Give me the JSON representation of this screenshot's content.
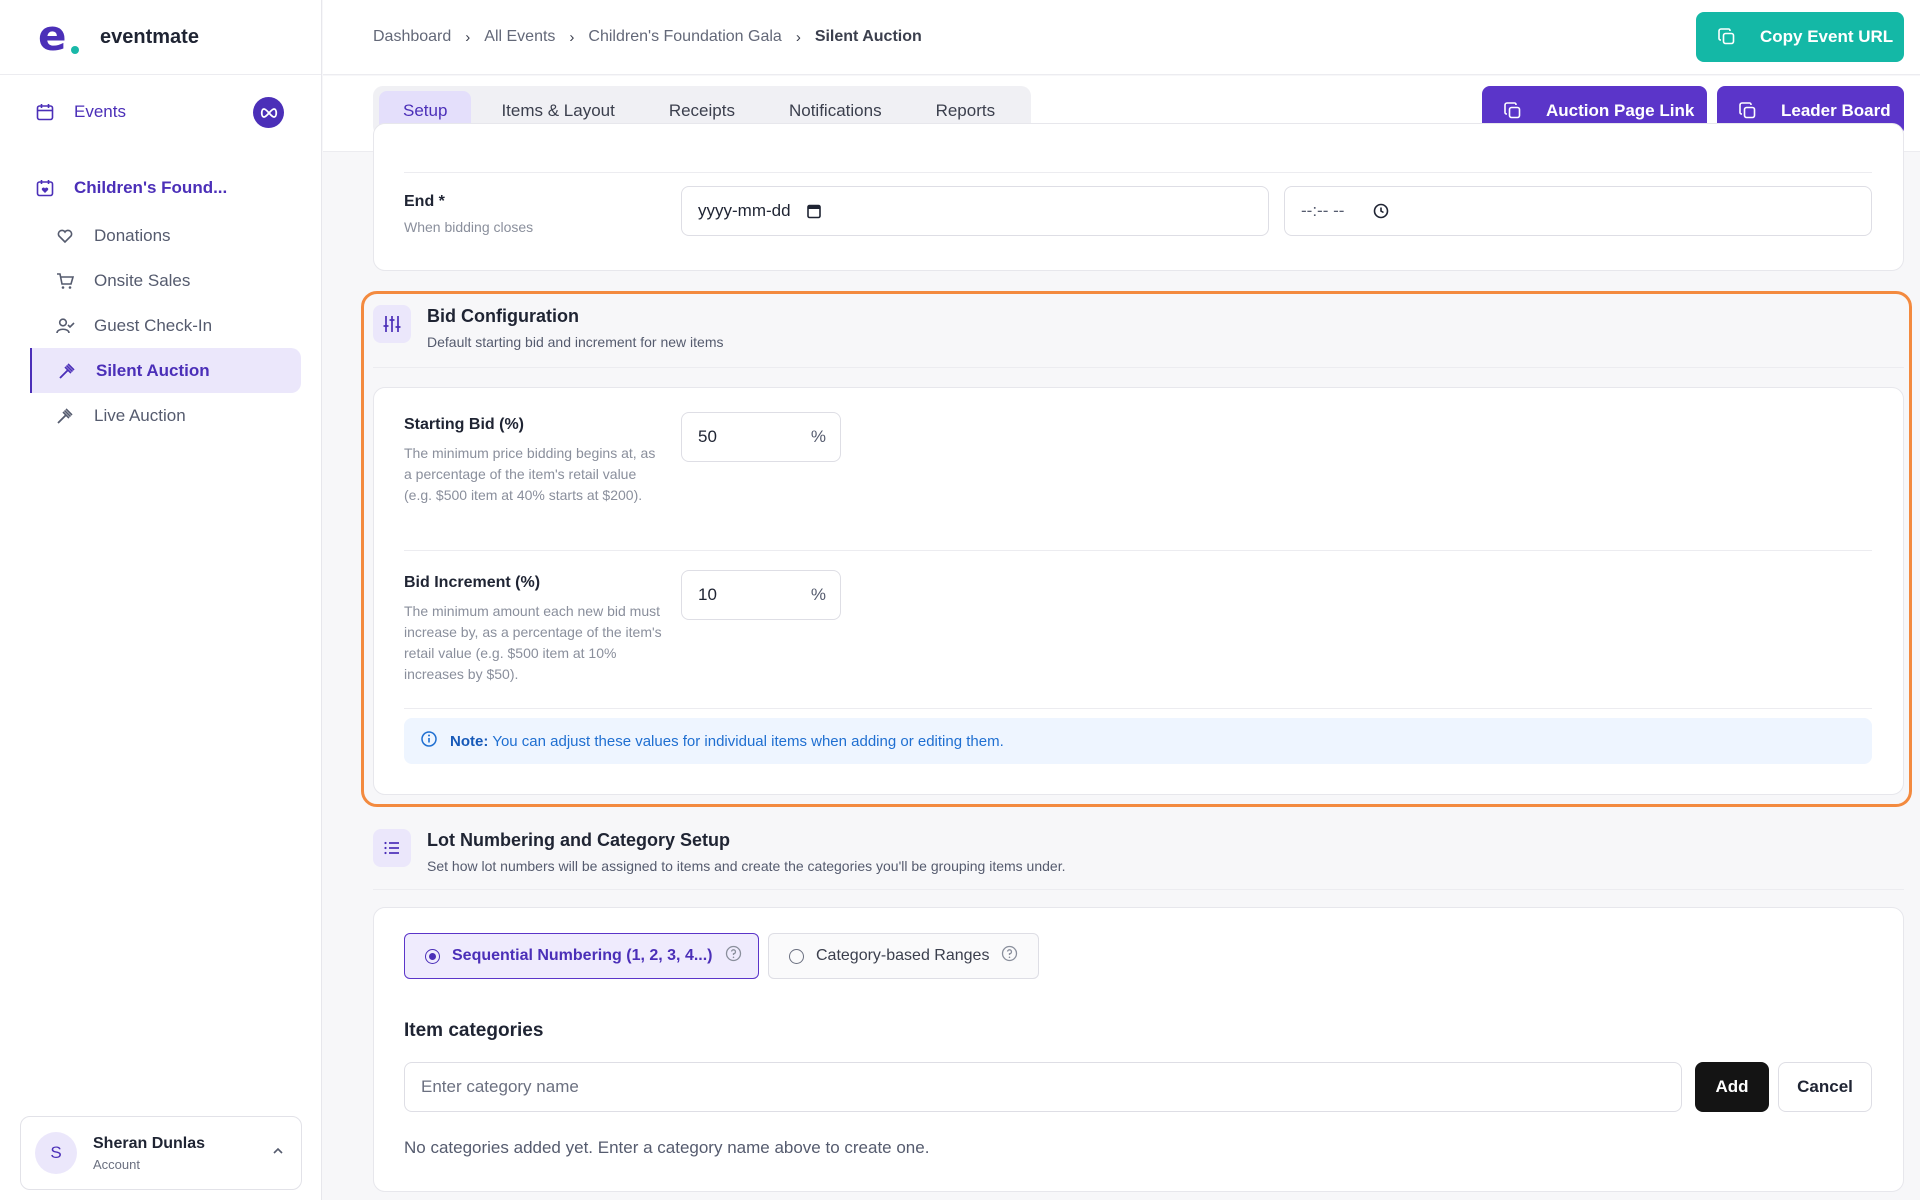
{
  "app": {
    "name": "eventmate"
  },
  "sidebar": {
    "events_label": "Events",
    "event_name": "Children's Found...",
    "items": [
      {
        "label": "Donations",
        "icon": "heart-hand-icon"
      },
      {
        "label": "Onsite Sales",
        "icon": "cart-icon"
      },
      {
        "label": "Guest Check-In",
        "icon": "user-check-icon"
      },
      {
        "label": "Silent Auction",
        "icon": "gavel-icon",
        "active": true
      },
      {
        "label": "Live Auction",
        "icon": "gavel-icon"
      }
    ],
    "account": {
      "initial": "S",
      "name": "Sheran Dunlas",
      "sub": "Account"
    }
  },
  "breadcrumb": [
    "Dashboard",
    "All Events",
    "Children's Foundation Gala",
    "Silent Auction"
  ],
  "header": {
    "copy_url_label": "Copy Event URL"
  },
  "tabs": [
    "Setup",
    "Items & Layout",
    "Receipts",
    "Notifications",
    "Reports"
  ],
  "actions": {
    "auction_page_link": "Auction Page Link",
    "leader_board": "Leader Board"
  },
  "end_field": {
    "label": "End *",
    "help": "When bidding closes",
    "date_placeholder": "yyyy-mm-dd",
    "time_placeholder": "--:-- --"
  },
  "bid_config": {
    "title": "Bid Configuration",
    "subtitle": "Default starting bid and increment for new items",
    "starting": {
      "label": "Starting Bid (%)",
      "help": "The minimum price bidding begins at, as a percentage of the item's retail value (e.g. $500 item at 40% starts at $200).",
      "value": "50",
      "suffix": "%"
    },
    "increment": {
      "label": "Bid Increment (%)",
      "help": "The minimum amount each new bid must increase by, as a percentage of the item's retail value (e.g. $500 item at 10% increases by $50).",
      "value": "10",
      "suffix": "%"
    },
    "note_label": "Note:",
    "note_text": "You can adjust these values for individual items when adding or editing them."
  },
  "lot": {
    "title": "Lot Numbering and Category Setup",
    "subtitle": "Set how lot numbers will be assigned to items and create the categories you'll be grouping items under.",
    "option_sequential": "Sequential Numbering (1, 2, 3, 4...)",
    "option_category": "Category-based Ranges",
    "categories_title": "Item categories",
    "category_placeholder": "Enter category name",
    "add_label": "Add",
    "cancel_label": "Cancel",
    "empty_text": "No categories added yet. Enter a category name above to create one."
  },
  "colors": {
    "brand": "#4b2fb8",
    "teal": "#14b8a6",
    "highlight": "#f38a3f",
    "note": "#1f6fd1"
  }
}
